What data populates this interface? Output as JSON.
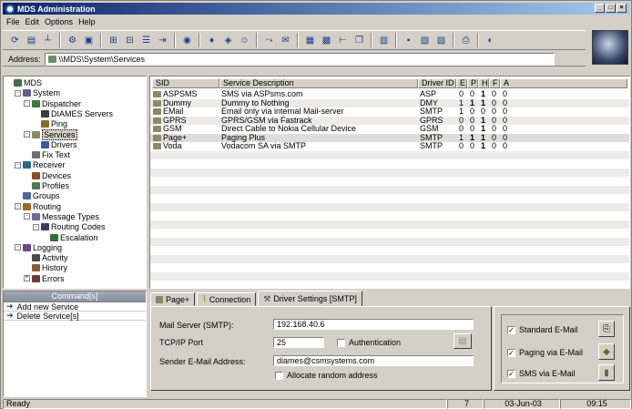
{
  "window": {
    "title": "MDS Administration"
  },
  "menu": [
    "File",
    "Edit",
    "Options",
    "Help"
  ],
  "address": {
    "label": "Address:",
    "value": "\\\\MDS\\System\\Services"
  },
  "tree": [
    {
      "label": "MDS",
      "level": 0,
      "icon": "server-icon",
      "box": ""
    },
    {
      "label": "System",
      "level": 1,
      "icon": "system-icon",
      "box": "-"
    },
    {
      "label": "Dispatcher",
      "level": 2,
      "icon": "dispatcher-icon",
      "box": "-"
    },
    {
      "label": "DIAMES Servers",
      "level": 3,
      "icon": "servers-icon",
      "box": ""
    },
    {
      "label": "Ping",
      "level": 3,
      "icon": "ping-icon",
      "box": ""
    },
    {
      "label": "Services",
      "level": 2,
      "icon": "services-icon",
      "box": "-",
      "selected": true
    },
    {
      "label": "Drivers",
      "level": 3,
      "icon": "drivers-icon",
      "box": ""
    },
    {
      "label": "Fix Text",
      "level": 2,
      "icon": "fixtext-icon",
      "box": ""
    },
    {
      "label": "Receiver",
      "level": 1,
      "icon": "receiver-icon",
      "box": "-"
    },
    {
      "label": "Devices",
      "level": 2,
      "icon": "devices-icon",
      "box": ""
    },
    {
      "label": "Profiles",
      "level": 2,
      "icon": "profiles-icon",
      "box": ""
    },
    {
      "label": "Groups",
      "level": 1,
      "icon": "groups-icon",
      "box": ""
    },
    {
      "label": "Routing",
      "level": 1,
      "icon": "routing-icon",
      "box": "-"
    },
    {
      "label": "Message Types",
      "level": 2,
      "icon": "message-types-icon",
      "box": "-"
    },
    {
      "label": "Routing Codes",
      "level": 3,
      "icon": "routing-codes-icon",
      "box": "-"
    },
    {
      "label": "Escalation",
      "level": 4,
      "icon": "escalation-icon",
      "box": ""
    },
    {
      "label": "Logging",
      "level": 1,
      "icon": "logging-icon",
      "box": "-"
    },
    {
      "label": "Activity",
      "level": 2,
      "icon": "activity-icon",
      "box": ""
    },
    {
      "label": "History",
      "level": 2,
      "icon": "history-icon",
      "box": ""
    },
    {
      "label": "Errors",
      "level": 2,
      "icon": "errors-icon",
      "box": "+"
    }
  ],
  "list": {
    "columns": [
      "SID",
      "Service Description",
      "Driver ID",
      "E",
      "P",
      "H",
      "F",
      "A"
    ],
    "rows": [
      {
        "sid": "ASPSMS",
        "desc": "SMS via ASPsms.com",
        "driver": "ASP",
        "e": "0",
        "p": "0",
        "h": "1",
        "f": "0",
        "a": "0"
      },
      {
        "sid": "Dummy",
        "desc": "Dummy to Nothing",
        "driver": "DMY",
        "e": "1",
        "p": "1",
        "h": "1",
        "f": "0",
        "a": "0"
      },
      {
        "sid": "EMail",
        "desc": "Email only via internal Mail-server",
        "driver": "SMTP",
        "e": "1",
        "p": "0",
        "h": "0",
        "f": "0",
        "a": "0"
      },
      {
        "sid": "GPRS",
        "desc": "GPRS/GSM via Fastrack",
        "driver": "GPRS",
        "e": "0",
        "p": "0",
        "h": "1",
        "f": "0",
        "a": "0"
      },
      {
        "sid": "GSM",
        "desc": "Direct Cable to Nokia Cellular Device",
        "driver": "GSM",
        "e": "0",
        "p": "0",
        "h": "1",
        "f": "0",
        "a": "0"
      },
      {
        "sid": "Page+",
        "desc": "Paging Plus",
        "driver": "SMTP",
        "e": "1",
        "p": "1",
        "h": "1",
        "f": "0",
        "a": "0"
      },
      {
        "sid": "Voda",
        "desc": "Vodacom SA via SMTP",
        "driver": "SMTP",
        "e": "0",
        "p": "0",
        "h": "1",
        "f": "0",
        "a": "0"
      }
    ]
  },
  "commands": {
    "header": "Command[s]",
    "items": [
      "Add new Service",
      "Delete Service[s]"
    ]
  },
  "tabs": [
    "Page+",
    "Connection",
    "Driver Settings [SMTP]"
  ],
  "form": {
    "mail_server_label": "Mail Server (SMTP):",
    "mail_server_value": "192.168.40.6",
    "port_label": "TCP/IP Port",
    "port_value": "25",
    "auth_label": "Authentication",
    "sender_label": "Sender E-Mail Address:",
    "sender_value": "diames@csmsystems.com",
    "random_label": "Allocate random address"
  },
  "options": {
    "standard": "Standard E-Mail",
    "paging": "Paging via E-Mail",
    "sms": "SMS via E-Mail"
  },
  "status": {
    "text": "Ready",
    "count": "7",
    "date": "03-Jun-03",
    "time": "09:15"
  }
}
